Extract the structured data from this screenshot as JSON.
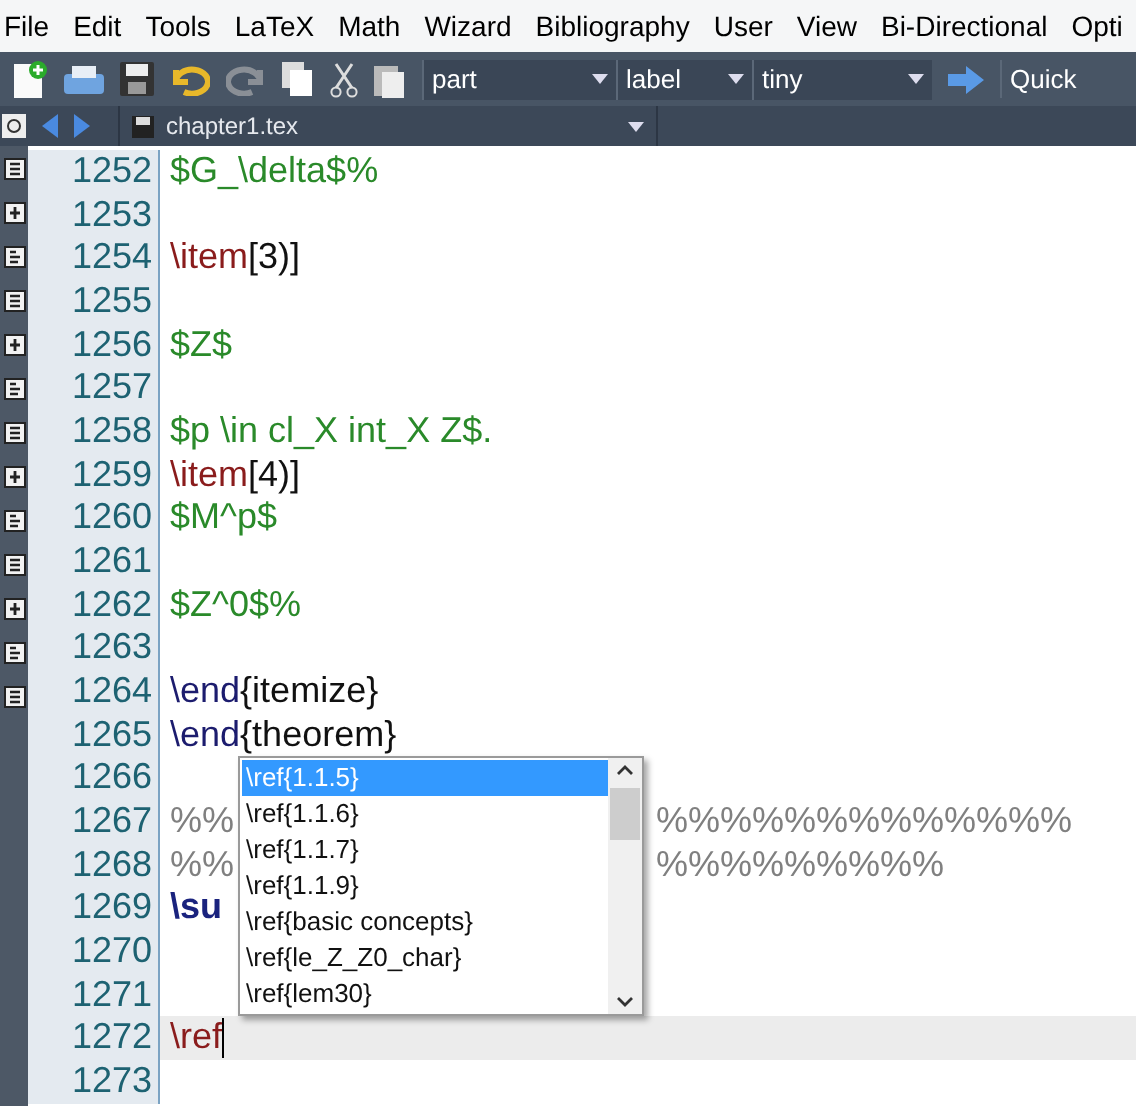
{
  "menu": [
    "File",
    "Edit",
    "Tools",
    "LaTeX",
    "Math",
    "Wizard",
    "Bibliography",
    "User",
    "View",
    "Bi-Directional",
    "Opti"
  ],
  "toolbar": {
    "combos": [
      "part",
      "label",
      "tiny"
    ],
    "quick": "Quick"
  },
  "tab": {
    "title": "chapter1.tex"
  },
  "lines": [
    {
      "number": "1252",
      "segments": [
        {
          "kind": "math",
          "text": "$G_\\delta$%"
        }
      ]
    },
    {
      "number": "1253"
    },
    {
      "number": "1254",
      "segments": [
        {
          "kind": "command",
          "text": "\\item"
        },
        {
          "kind": "plain",
          "text": "[3)]"
        }
      ]
    },
    {
      "number": "1255"
    },
    {
      "number": "1256",
      "segments": [
        {
          "kind": "math",
          "text": "$Z$"
        }
      ]
    },
    {
      "number": "1257"
    },
    {
      "number": "1258",
      "segments": [
        {
          "kind": "math",
          "text": "$p \\in cl_X int_X Z$."
        }
      ]
    },
    {
      "number": "1259",
      "segments": [
        {
          "kind": "command",
          "text": "\\item"
        },
        {
          "kind": "plain",
          "text": "[4)]"
        }
      ]
    },
    {
      "number": "1260",
      "segments": [
        {
          "kind": "math",
          "text": "$M^p$"
        }
      ]
    },
    {
      "number": "1261"
    },
    {
      "number": "1262",
      "segments": [
        {
          "kind": "math",
          "text": "$Z^0$%"
        }
      ]
    },
    {
      "number": "1263"
    },
    {
      "number": "1264",
      "segments": [
        {
          "kind": "keyword",
          "text": "\\end"
        },
        {
          "kind": "plain",
          "text": "{itemize}"
        }
      ]
    },
    {
      "number": "1265",
      "segments": [
        {
          "kind": "keyword",
          "text": "\\end"
        },
        {
          "kind": "plain",
          "text": "{theorem}"
        }
      ]
    },
    {
      "number": "1266"
    },
    {
      "number": "1267",
      "segments": [
        {
          "kind": "comment",
          "text": "%%"
        }
      ],
      "tail": {
        "kind": "comment",
        "text": "%%%%%%%%%%%%%"
      }
    },
    {
      "number": "1268",
      "segments": [
        {
          "kind": "comment",
          "text": "%%"
        }
      ],
      "tail": {
        "kind": "comment",
        "text": "%%%%%%%%%"
      }
    },
    {
      "number": "1269",
      "segments": [
        {
          "kind": "section",
          "text": "\\su"
        }
      ]
    },
    {
      "number": "1270"
    },
    {
      "number": "1271"
    },
    {
      "number": "1272",
      "current": true,
      "segments": [
        {
          "kind": "command",
          "text": "\\ref"
        }
      ]
    },
    {
      "number": "1273"
    }
  ],
  "completion": [
    {
      "text": "\\ref{1.1.5}",
      "selected": true
    },
    {
      "text": "\\ref{1.1.6}",
      "selected": false
    },
    {
      "text": "\\ref{1.1.7}",
      "selected": false
    },
    {
      "text": "\\ref{1.1.9}",
      "selected": false
    },
    {
      "text": "\\ref{basic concepts}",
      "selected": false
    },
    {
      "text": "\\ref{le_Z_Z0_char}",
      "selected": false
    },
    {
      "text": "\\ref{lem30}",
      "selected": false
    }
  ]
}
